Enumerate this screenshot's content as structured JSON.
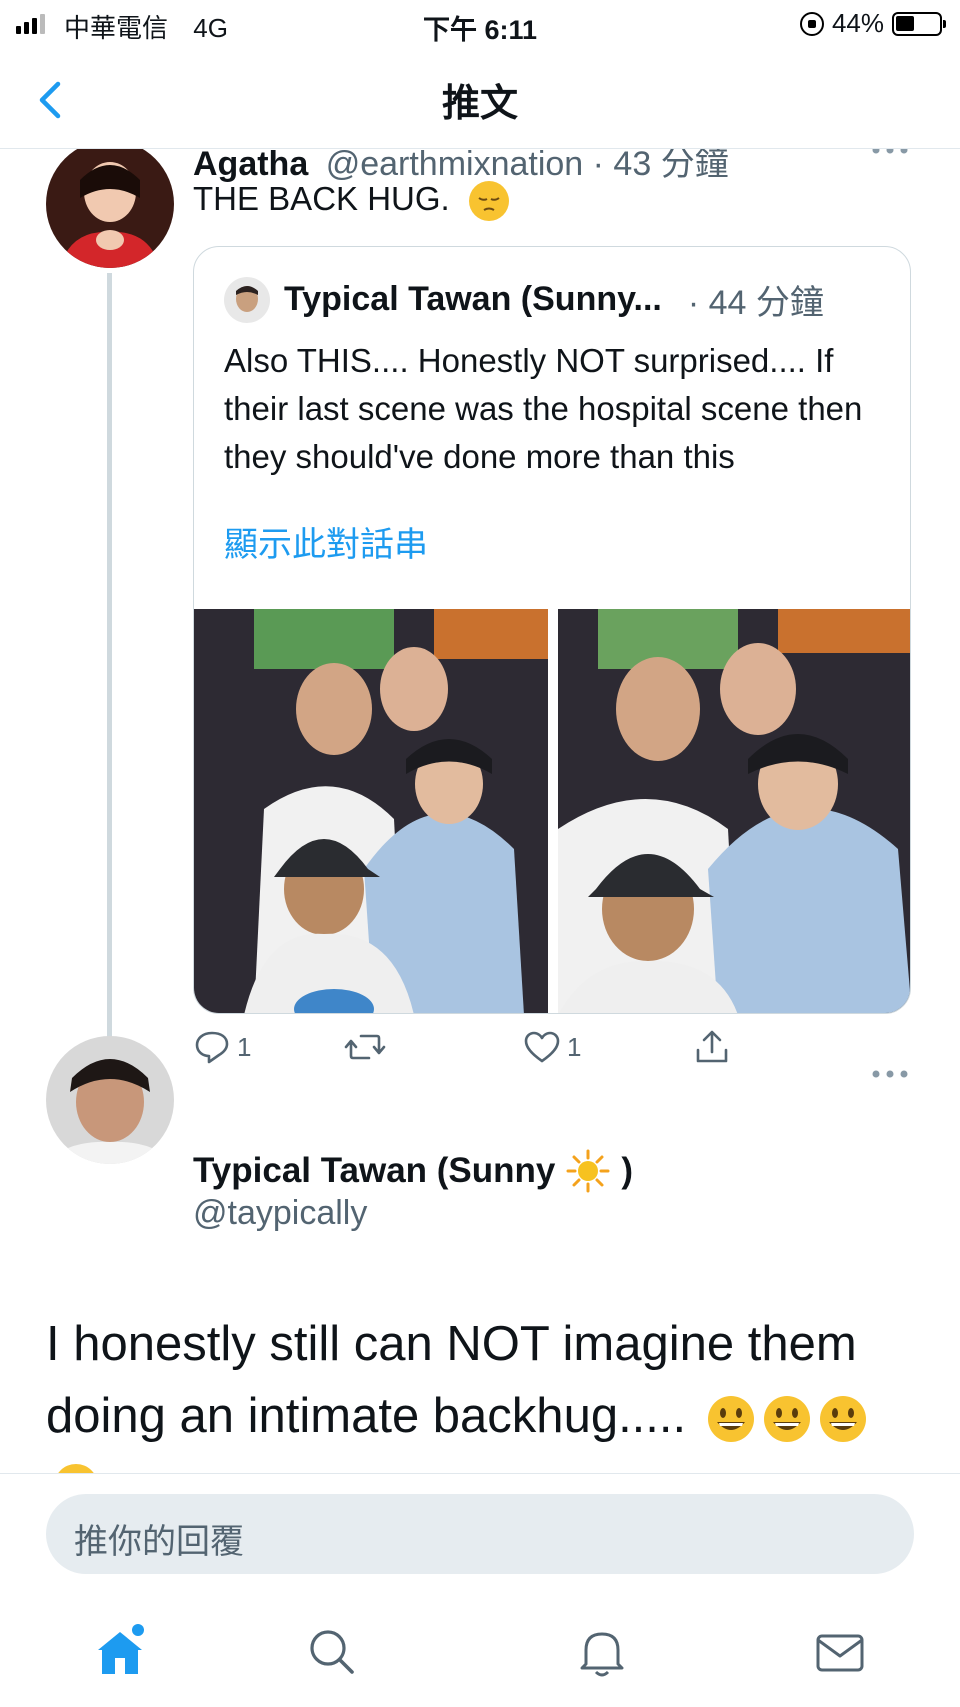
{
  "status_bar": {
    "carrier": "中華電信",
    "network": "4G",
    "time": "下午 6:11",
    "battery_text": "44%",
    "battery_level": 0.44
  },
  "nav": {
    "title": "推文",
    "back_icon": "chevron-left-icon"
  },
  "parent_tweet": {
    "name": "Agatha",
    "handle_time": "@earthmixnation · 43 分鐘",
    "text": "THE BACK HUG.",
    "emoji": "pensive-face",
    "quote": {
      "name": "Typical Tawan (Sunny...",
      "time": "· 44 分鐘",
      "text": "Also THIS.... Honestly NOT surprised.... If their last scene was the hospital scene then they should've done more than this",
      "show_thread": "顯示此對話串"
    },
    "actions": {
      "reply_count": "1",
      "like_count": "1"
    }
  },
  "main_tweet": {
    "name_before": "Typical Tawan (Sunny",
    "name_after": ")",
    "handle": "@taypically",
    "text": "I honestly still can NOT imagine them doing an intimate backhug.....",
    "emojis": [
      "grinning-face",
      "grinning-face",
      "grinning-face"
    ]
  },
  "reply": {
    "placeholder": "推你的回覆"
  },
  "tabbar": [
    "home-icon",
    "search-icon",
    "notifications-icon",
    "messages-icon"
  ],
  "colors": {
    "accent": "#1d9bf0",
    "text": "#0f1419",
    "secondary": "#536471",
    "border": "#cfd9de"
  }
}
